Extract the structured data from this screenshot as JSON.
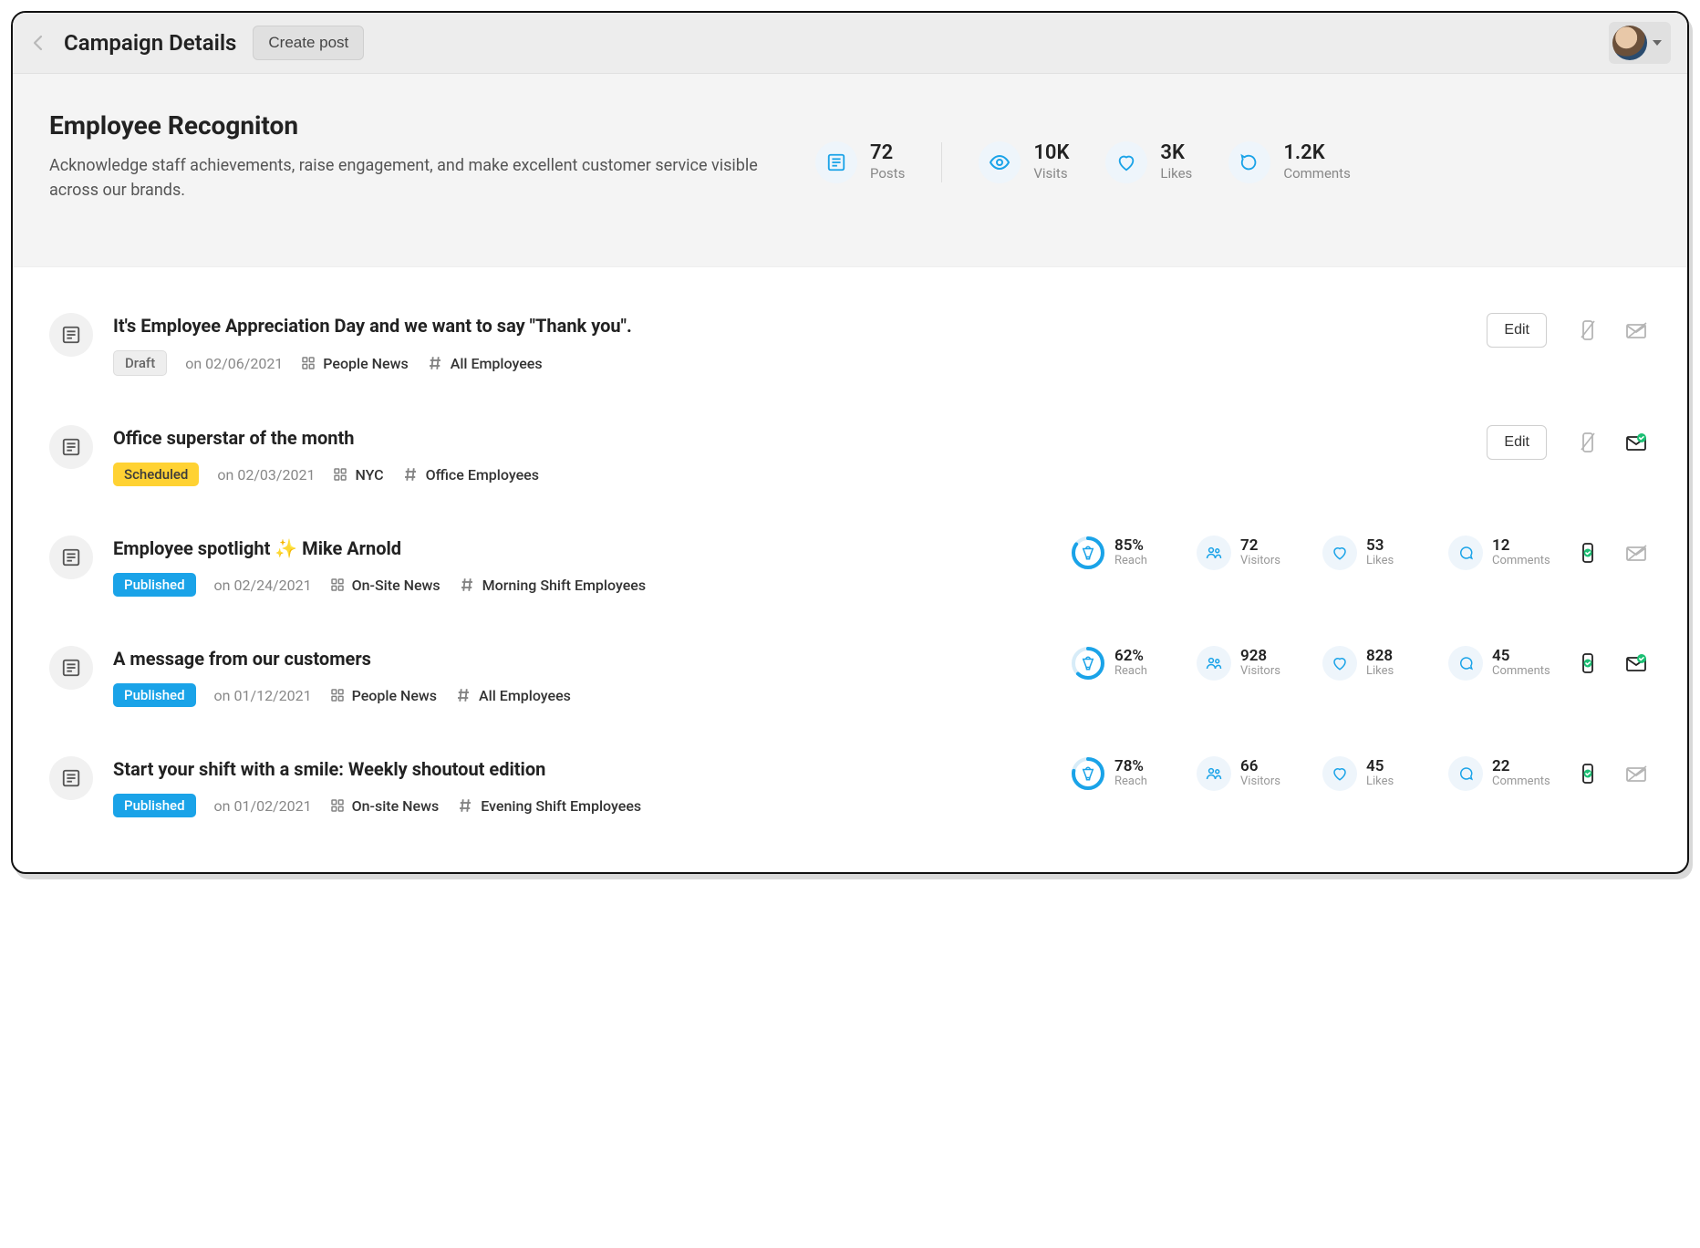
{
  "header": {
    "title": "Campaign Details",
    "create_post": "Create post"
  },
  "hero": {
    "title": "Employee Recogniton",
    "description": "Acknowledge staff achievements, raise engagement, and make excellent customer service visible across our brands.",
    "stats": {
      "posts": {
        "value": "72",
        "label": "Posts"
      },
      "visits": {
        "value": "10K",
        "label": "Visits"
      },
      "likes": {
        "value": "3K",
        "label": "Likes"
      },
      "comments": {
        "value": "1.2K",
        "label": "Comments"
      }
    }
  },
  "labels": {
    "edit": "Edit",
    "reach": "Reach",
    "visitors": "Visitors",
    "likes": "Likes",
    "comments": "Comments",
    "on_prefix": "on "
  },
  "posts": [
    {
      "title": "It's Employee Appreciation Day and we want to say \"Thank you\".",
      "status": "Draft",
      "status_kind": "draft",
      "date": "02/06/2021",
      "category": "People News",
      "audience": "All Employees",
      "editable": true,
      "channels": {
        "push": false,
        "email": false
      },
      "metrics": null
    },
    {
      "title": "Office superstar of the month",
      "status": "Scheduled",
      "status_kind": "scheduled",
      "date": "02/03/2021",
      "category": "NYC",
      "audience": "Office Employees",
      "editable": true,
      "channels": {
        "push": false,
        "email": true
      },
      "metrics": null
    },
    {
      "title": "Employee spotlight ✨ Mike Arnold",
      "status": "Published",
      "status_kind": "published",
      "date": "02/24/2021",
      "category": "On-Site News",
      "audience": "Morning Shift Employees",
      "editable": false,
      "channels": {
        "push": true,
        "email": false
      },
      "metrics": {
        "reach_pct": 85,
        "reach": "85%",
        "visitors": "72",
        "likes": "53",
        "comments": "12"
      }
    },
    {
      "title": "A message from our customers",
      "status": "Published",
      "status_kind": "published",
      "date": "01/12/2021",
      "category": "People News",
      "audience": "All Employees",
      "editable": false,
      "channels": {
        "push": true,
        "email": true
      },
      "metrics": {
        "reach_pct": 62,
        "reach": "62%",
        "visitors": "928",
        "likes": "828",
        "comments": "45"
      }
    },
    {
      "title": "Start your shift with a smile: Weekly shoutout edition",
      "status": "Published",
      "status_kind": "published",
      "date": "01/02/2021",
      "category": "On-site News",
      "audience": "Evening Shift Employees",
      "editable": false,
      "channels": {
        "push": true,
        "email": false
      },
      "metrics": {
        "reach_pct": 78,
        "reach": "78%",
        "visitors": "66",
        "likes": "45",
        "comments": "22"
      }
    }
  ]
}
